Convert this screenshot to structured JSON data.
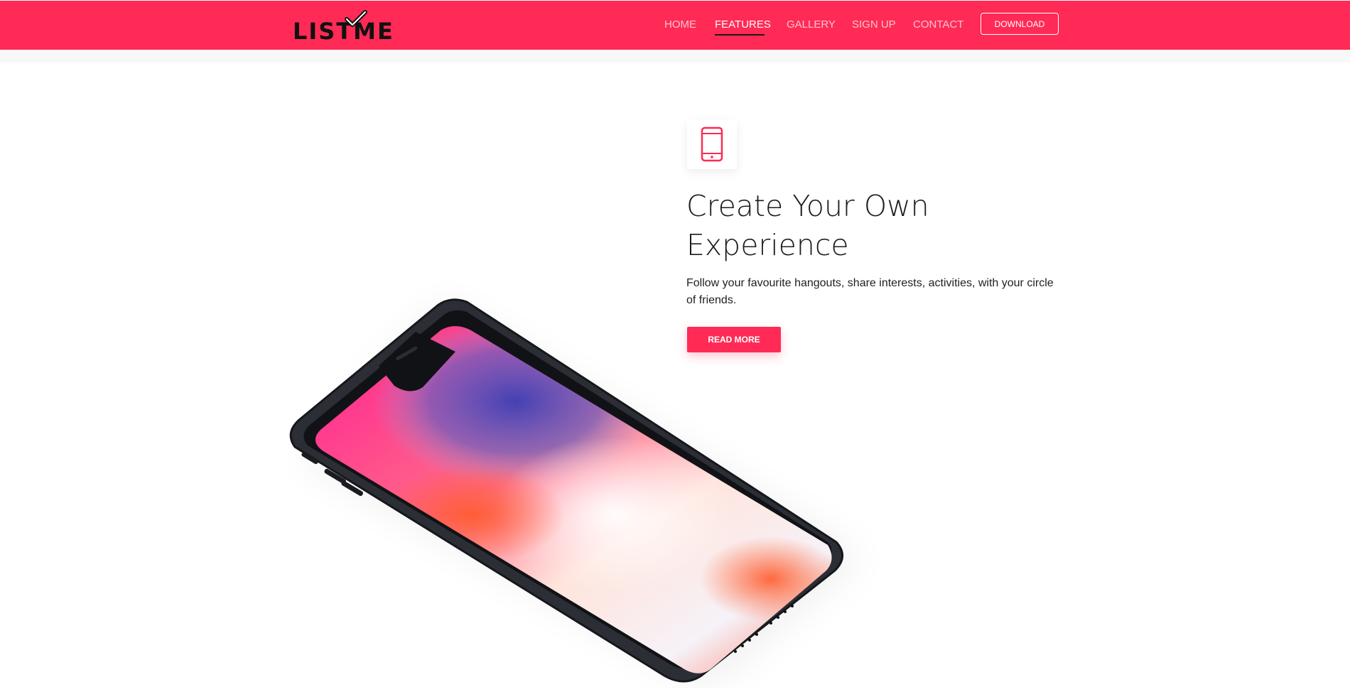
{
  "header": {
    "logo_text": "LISTME",
    "nav": [
      {
        "label": "HOME"
      },
      {
        "label": "FEATURES"
      },
      {
        "label": "GALLERY"
      },
      {
        "label": "SIGN UP"
      },
      {
        "label": "CONTACT"
      }
    ],
    "active_nav": "FEATURES",
    "download_label": "DOWNLOAD"
  },
  "feature": {
    "icon": "tablet-icon",
    "title_line1": "Create Your Own",
    "title_line2": "Experience",
    "description": "Follow your favourite hangouts, share interests, activities, with your circle of friends.",
    "button_label": "READ MORE"
  },
  "colors": {
    "brand": "#ff2a55",
    "text": "#1c1c1c",
    "nav_inactive": "#ffc4d0"
  }
}
